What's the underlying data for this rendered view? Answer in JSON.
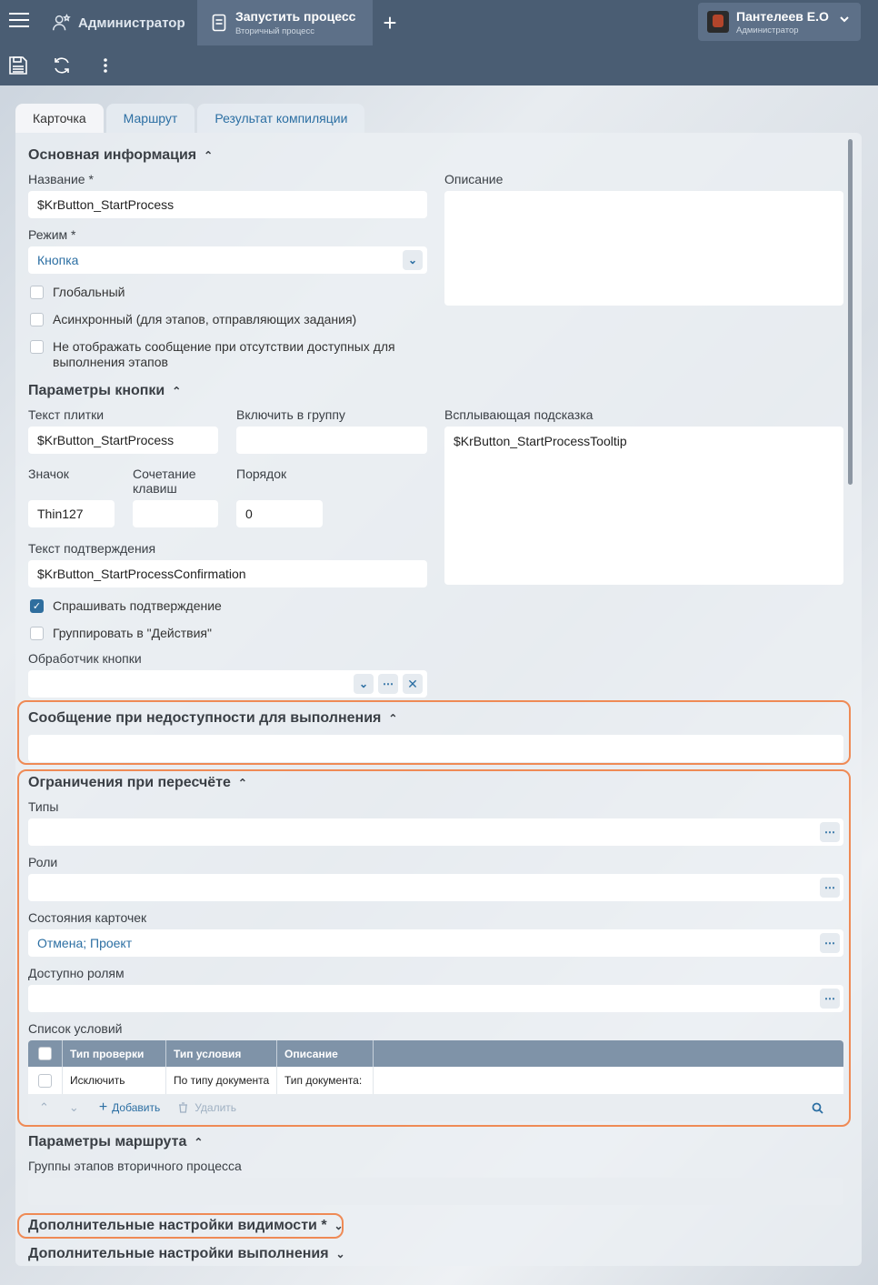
{
  "topbar": {
    "admin_tab_label": "Администратор",
    "active_tab_title": "Запустить процесс",
    "active_tab_subtitle": "Вторичный процесс",
    "add_tab_label": "+",
    "user_name": "Пантелеев Е.О",
    "user_role": "Администратор"
  },
  "card_tabs": [
    "Карточка",
    "Маршрут",
    "Результат компиляции"
  ],
  "main_info": {
    "title": "Основная информация",
    "name_label": "Название  *",
    "name_value": "$KrButton_StartProcess",
    "mode_label": "Режим  *",
    "mode_value": "Кнопка",
    "description_label": "Описание",
    "checkboxes": [
      {
        "label": "Глобальный",
        "checked": false
      },
      {
        "label": "Асинхронный (для этапов, отправляющих задания)",
        "checked": false
      },
      {
        "label": "Не отображать сообщение при отсутствии доступных для выполнения этапов",
        "checked": false
      }
    ]
  },
  "button_params": {
    "title": "Параметры кнопки",
    "tile_text_label": "Текст плитки",
    "tile_text_value": "$KrButton_StartProcess",
    "group_label": "Включить в группу",
    "tooltip_label": "Всплывающая подсказка",
    "tooltip_value": "$KrButton_StartProcessTooltip",
    "icon_label": "Значок",
    "icon_value": "Thin127",
    "hotkey_label": "Сочетание клавиш",
    "order_label": "Порядок",
    "order_value": "0",
    "confirm_label": "Текст подтверждения",
    "confirm_value": "$KrButton_StartProcessConfirmation",
    "ask_confirm_label": "Спрашивать подтверждение",
    "group_actions_label": "Группировать в \"Действия\"",
    "handler_label": "Обработчик кнопки"
  },
  "unavailable_message": {
    "title": "Сообщение при недоступности для выполнения"
  },
  "restrictions": {
    "title": "Ограничения при пересчёте",
    "types_label": "Типы",
    "roles_label": "Роли",
    "states_label": "Состояния карточек",
    "states_value": "Отмена; Проект",
    "available_roles_label": "Доступно ролям",
    "conditions_label": "Список условий",
    "grid": {
      "headers": [
        "Тип проверки",
        "Тип условия",
        "Описание"
      ],
      "rows": [
        [
          "Исключить",
          "По типу документа",
          "Тип документа:"
        ]
      ],
      "add_label": "Добавить",
      "delete_label": "Удалить"
    }
  },
  "route_params": {
    "title": "Параметры маршрута",
    "groups_label": "Группы этапов вторичного процесса"
  },
  "extra_visibility": {
    "title": "Дополнительные настройки видимости *"
  },
  "extra_execution": {
    "title": "Дополнительные настройки выполнения"
  },
  "colors": {
    "header": "#4a5d73",
    "active_tab": "#5d7088",
    "link": "#2c6fa3",
    "highlight": "#ef8a55",
    "grid_header": "#7f93a8"
  }
}
